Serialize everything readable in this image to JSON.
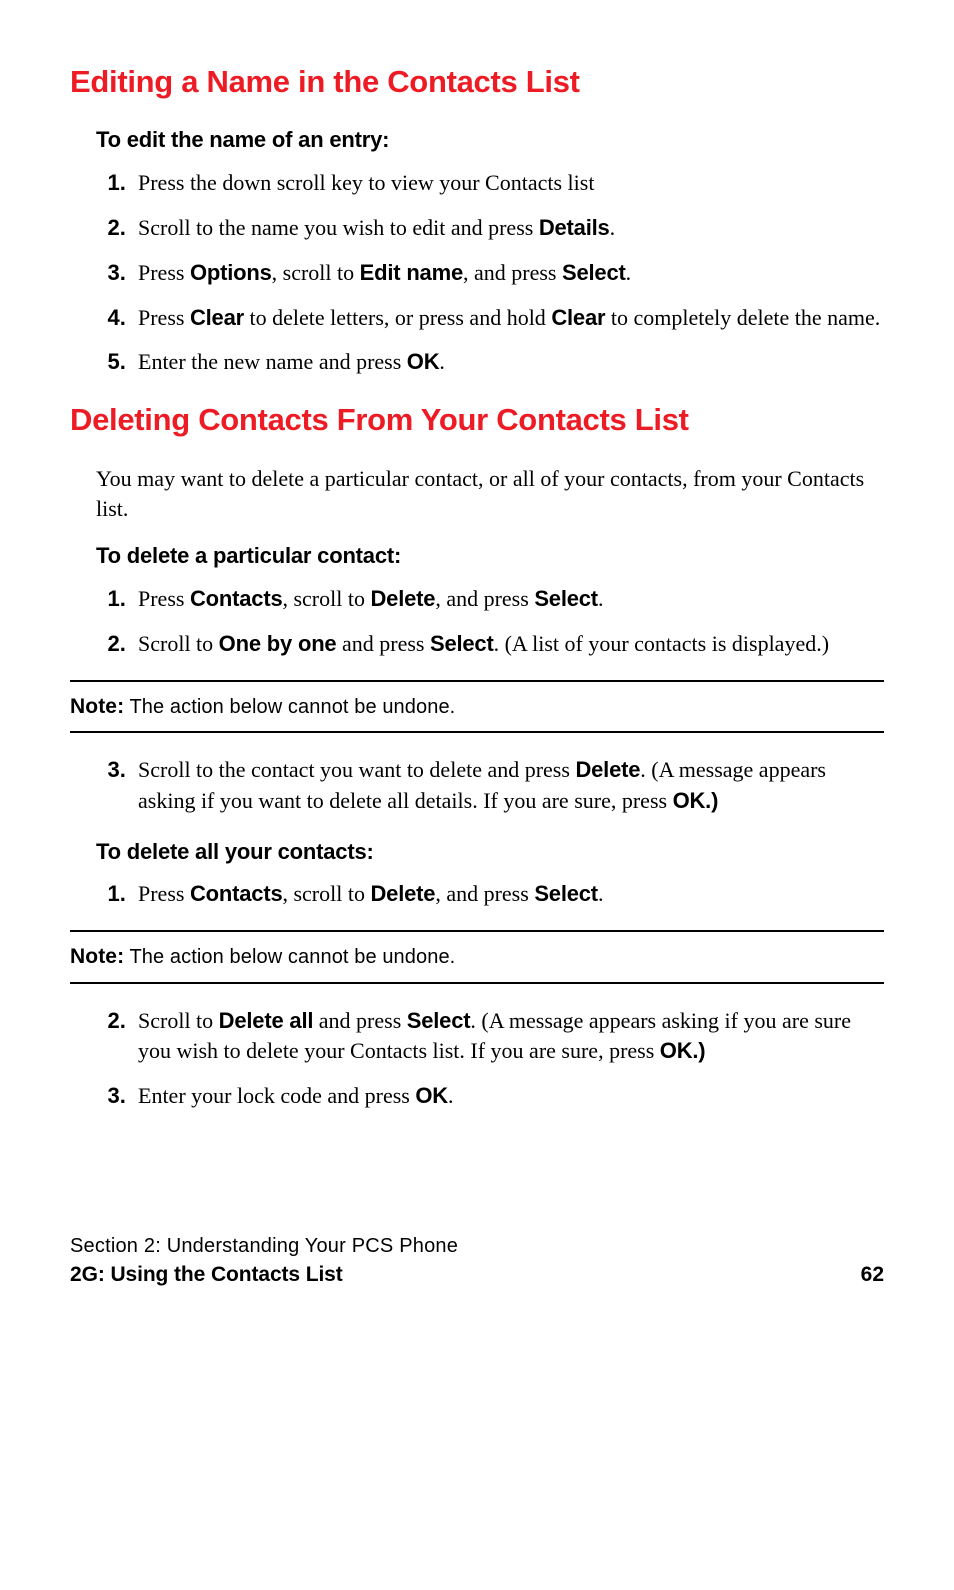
{
  "h1": "Editing a Name in the Contacts List",
  "edit": {
    "subhead": "To edit the name of an entry:",
    "s1": "Press the down scroll key to view your Contacts list",
    "s2a": "Scroll to the name you wish to edit and press ",
    "s2b": "Details",
    "s2c": ".",
    "s3a": "Press ",
    "s3b": "Options",
    "s3c": ", scroll to ",
    "s3d": "Edit name",
    "s3e": ", and press ",
    "s3f": "Select",
    "s3g": ".",
    "s4a": "Press ",
    "s4b": "Clear",
    "s4c": " to delete letters, or press and hold ",
    "s4d": "Clear",
    "s4e": " to completely delete the name.",
    "s5a": "Enter the new name and press ",
    "s5b": "OK",
    "s5c": "."
  },
  "h2": "Deleting Contacts From Your Contacts List",
  "del": {
    "intro": "You may want to delete a particular contact, or all of your contacts, from your Contacts list.",
    "subhead1": "To delete a particular contact:",
    "p1a": "Press ",
    "p1b": "Contacts",
    "p1c": ", scroll to ",
    "p1d": "Delete",
    "p1e": ", and press ",
    "p1f": "Select",
    "p1g": ".",
    "p2a": "Scroll to ",
    "p2b": "One by one",
    "p2c": " and press ",
    "p2d": "Select",
    "p2e": ". (A list of your contacts is displayed.)",
    "p3a": "Scroll to the contact you want to delete and press ",
    "p3b": "Delete",
    "p3c": ". (A message appears asking if you want to delete all details. If you are sure, press ",
    "p3d": "OK.)",
    "subhead2": "To delete all your contacts:",
    "a1a": "Press ",
    "a1b": "Contacts",
    "a1c": ", scroll to ",
    "a1d": "Delete",
    "a1e": ", and press ",
    "a1f": "Select",
    "a1g": ".",
    "a2a": "Scroll to ",
    "a2b": "Delete all",
    "a2c": " and press ",
    "a2d": "Select",
    "a2e": ". (A message appears asking if you are sure you wish to delete your Contacts list. If you are sure, press ",
    "a2f": "OK.)",
    "a3a": "Enter your lock code and press ",
    "a3b": "OK",
    "a3c": "."
  },
  "note": {
    "label": "Note:",
    "text": " The action below cannot be undone."
  },
  "footer": {
    "line1": "Section 2: Understanding Your PCS Phone",
    "line2": "2G: Using the Contacts List",
    "page": "62"
  }
}
